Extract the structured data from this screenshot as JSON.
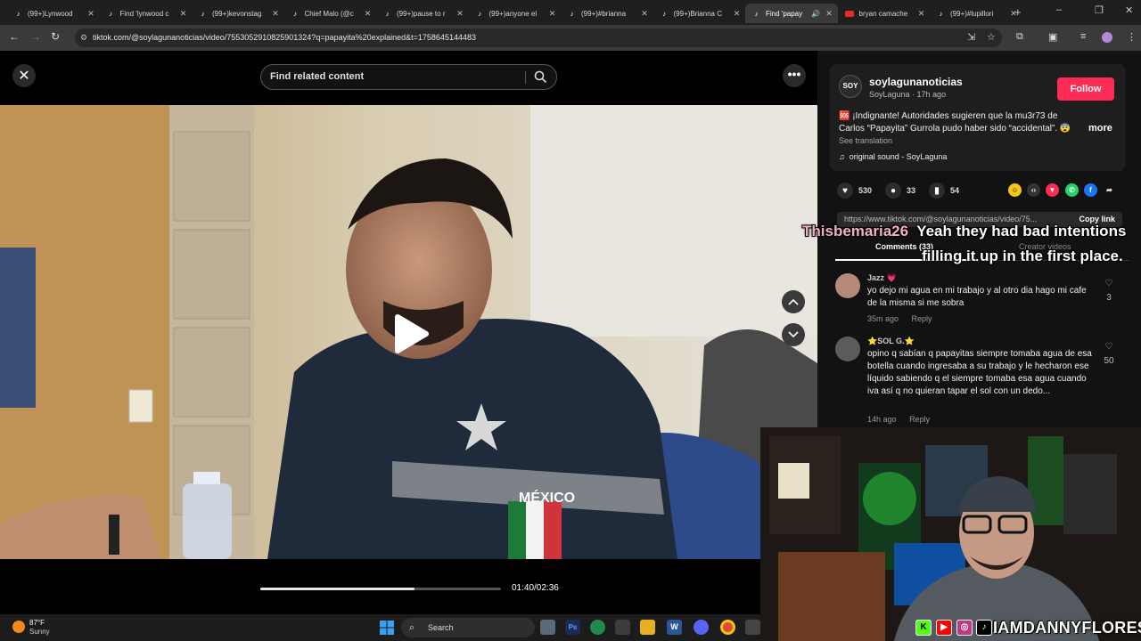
{
  "browser": {
    "tabs": [
      {
        "title": "(99+)Lynwood",
        "icon": "tiktok-icon"
      },
      {
        "title": "Find 'lynwood c",
        "icon": "tiktok-icon"
      },
      {
        "title": "(99+)kevonstag",
        "icon": "tiktok-icon"
      },
      {
        "title": "Chief Malo (@c",
        "icon": "tiktok-icon"
      },
      {
        "title": "(99+)pause to r",
        "icon": "tiktok-icon"
      },
      {
        "title": "(99+)anyone el",
        "icon": "tiktok-icon"
      },
      {
        "title": "(99+)#brianna",
        "icon": "tiktok-icon"
      },
      {
        "title": "(99+)Brianna C",
        "icon": "tiktok-icon"
      },
      {
        "title": "Find 'papay",
        "icon": "tiktok-icon",
        "active": true,
        "audio": true
      },
      {
        "title": "bryan camache",
        "icon": "youtube-icon"
      },
      {
        "title": "(99+)#lupillori",
        "icon": "tiktok-icon"
      }
    ],
    "url": "tiktok.com/@soylagunanoticias/video/7553052910825901324?q=papayita%20explained&t=1758645144483"
  },
  "player": {
    "search_placeholder": "Find related content",
    "time": "01:40/02:36",
    "progress": 0.64
  },
  "author": {
    "avatar_text": "SOY",
    "username": "soylagunanoticias",
    "nick": "SoyLaguna · 17h ago",
    "follow_label": "Follow",
    "description": "🆘 ¡Indignante! Autoridades sugieren que la mu3r73 de Carlos “Papayita” Gurrola pudo haber sido “accidental”. 😨 ...",
    "more_label": "more",
    "see_translation": "See translation",
    "sound": "original sound - SoyLaguna"
  },
  "actions": {
    "likes": "530",
    "comments": "33",
    "saves": "54"
  },
  "link": {
    "url": "https://www.tiktok.com/@soylagunanoticias/video/75...",
    "copy_label": "Copy link"
  },
  "comment_tabs": {
    "comments": "Comments (33)",
    "creator": "Creator videos"
  },
  "comments": [
    {
      "user": "Jazz 💗",
      "text": "yo dejo mi agua en mi trabajo y al otro dia hago mi cafe de la misma si me sobra",
      "time": "35m ago",
      "reply": "Reply",
      "likes": "3"
    },
    {
      "user": "⭐SOL G.⭐",
      "text": "opino q sabían q papayitas siempre tomaba agua de esa botella cuando ingresaba a su trabajo y le hecharon ese líquido sabiendo q el siempre tomaba esa agua cuando iva así q no quieran tapar el sol con un dedo...",
      "time": "14h ago",
      "reply": "Reply",
      "likes": "50"
    }
  ],
  "overlay": {
    "user": "Thisbemaria26",
    "line1": "Yeah they had bad intentions",
    "line2": "filling it up in the first place."
  },
  "stream": {
    "handle": "IAMDANNYFLORES"
  },
  "taskbar": {
    "temp": "87°F",
    "weather": "Sunny",
    "search_label": "Search"
  },
  "colors": {
    "accent": "#fe2c55",
    "panel": "#121212"
  }
}
